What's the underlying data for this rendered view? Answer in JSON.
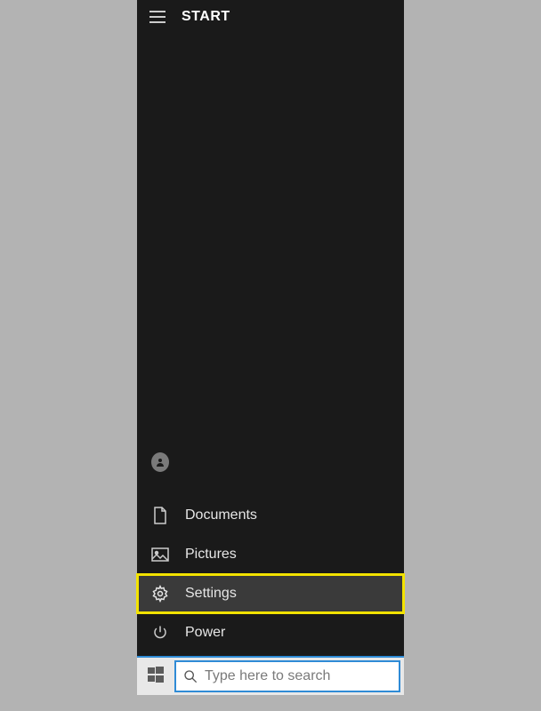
{
  "header": {
    "title": "START"
  },
  "menu": {
    "documents_label": "Documents",
    "pictures_label": "Pictures",
    "settings_label": "Settings",
    "power_label": "Power"
  },
  "taskbar": {
    "search_placeholder": "Type here to search"
  }
}
